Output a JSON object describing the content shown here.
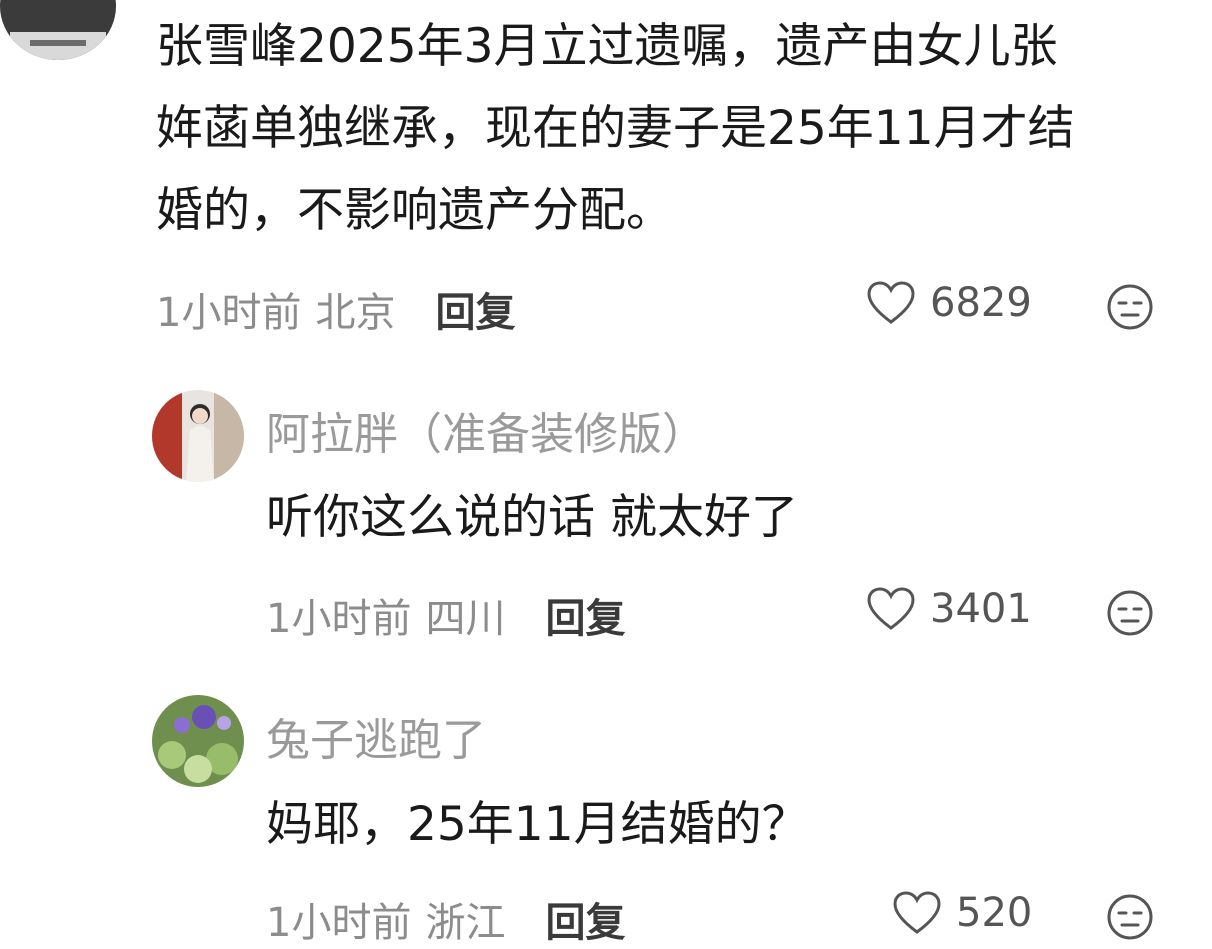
{
  "main_comment": {
    "text_lines": [
      "张雪峰2025年3月立过遗嘱，遗产由女儿张",
      "姩菡单独继承，现在的妻子是25年11月才结",
      "婚的，不影响遗产分配。"
    ],
    "time": "1小时前",
    "location": "北京",
    "reply_label": "回复",
    "likes": "6829"
  },
  "replies": [
    {
      "username": "阿拉胖（准备装修版）",
      "text": "听你这么说的话 就太好了",
      "time": "1小时前",
      "location": "四川",
      "reply_label": "回复",
      "likes": "3401"
    },
    {
      "username": "兔子逃跑了",
      "text": "妈耶，25年11月结婚的？",
      "time": "1小时前",
      "location": "浙江",
      "reply_label": "回复",
      "likes": "520"
    }
  ],
  "icons": {
    "like": "heart-outline-icon",
    "dislike": "unamused-face-icon"
  }
}
